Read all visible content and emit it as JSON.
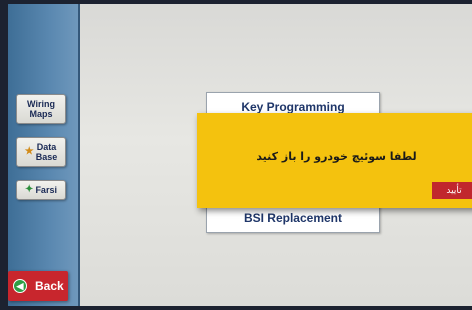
{
  "sidebar": {
    "items": [
      {
        "label_line1": "Wiring",
        "label_line2": "Maps",
        "icon": "none"
      },
      {
        "label_line1": "Data",
        "label_line2": "Base",
        "icon": "folder-icon"
      },
      {
        "label": "Farsi",
        "icon": "language-icon"
      }
    ]
  },
  "menu": {
    "items": [
      {
        "label": "Key Programming"
      },
      {
        "label": "BSI Replacement"
      }
    ]
  },
  "dialog": {
    "message": "لطفا سوئیچ خودرو را باز کنید",
    "confirm_label": "تأیید"
  },
  "footer": {
    "back_label": "Back",
    "back_icon": "arrow-left-icon"
  },
  "colors": {
    "dialog_background": "#f4c20e",
    "button_red": "#c8262d",
    "sidebar_blue": "#4f7ea6",
    "menu_text": "#1f3669"
  }
}
